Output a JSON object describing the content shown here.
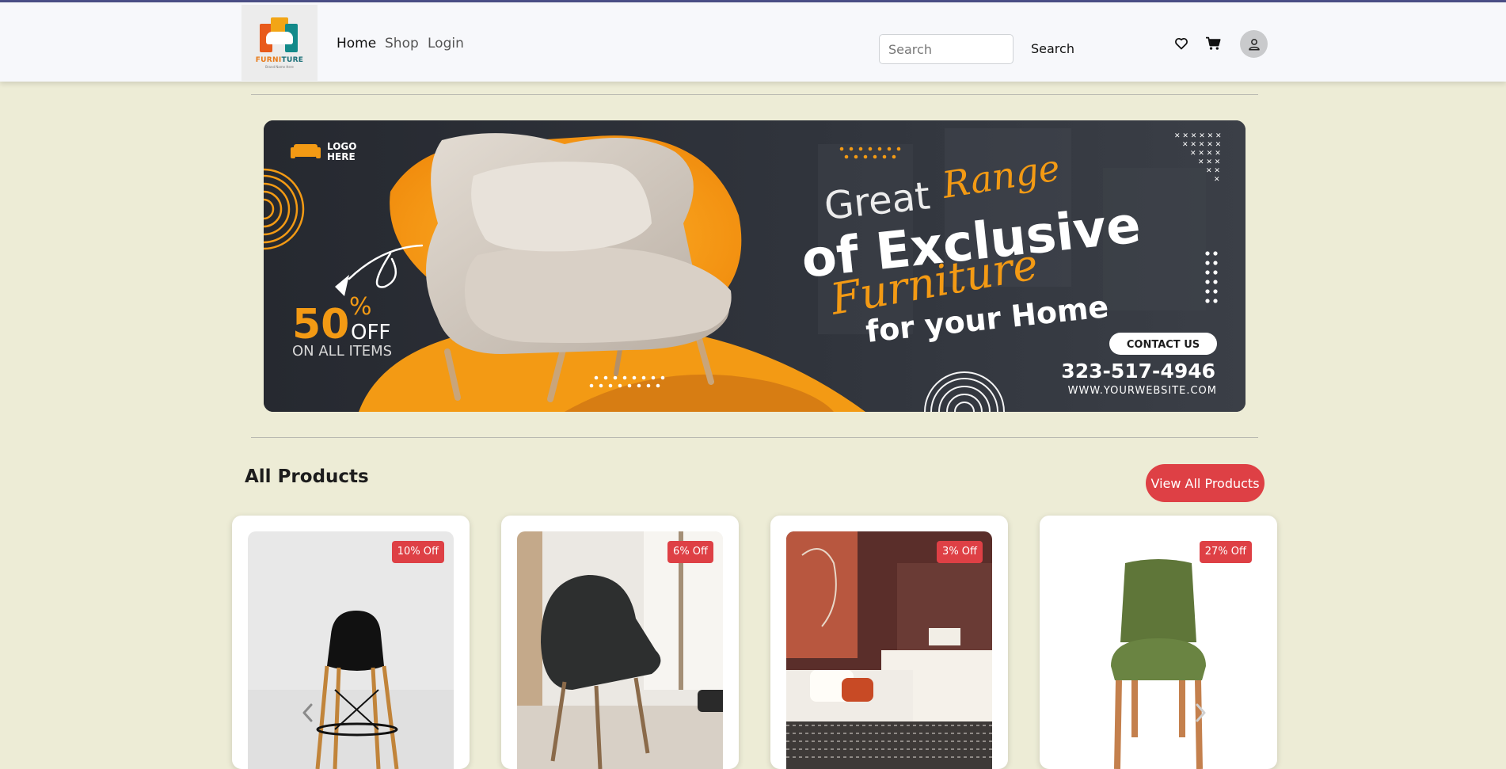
{
  "nav": {
    "logo_word_1": "FURNI",
    "logo_word_2": "TURE",
    "logo_tagline": "Brand Name Here",
    "links": [
      "Home",
      "Shop",
      "Login"
    ],
    "search_placeholder": "Search",
    "search_button": "Search",
    "icons": [
      "heart-icon",
      "cart-icon",
      "user-icon"
    ]
  },
  "banner": {
    "logo_line1": "LOGO",
    "logo_line2": "HERE",
    "discount_number": "50",
    "discount_pct": "%",
    "discount_off": "OFF",
    "discount_sub": "ON ALL ITEMS",
    "headline_great": "Great",
    "headline_range": "Range",
    "headline_exclusive": "of Exclusive",
    "headline_furniture": "Furniture",
    "headline_home": "for your Home",
    "contact_button": "CONTACT US",
    "phone": "323-517-4946",
    "website": "WWW.YOURWEBSITE.COM",
    "accent_color": "#f39a14"
  },
  "products_section": {
    "title": "All Products",
    "view_all": "View All Products",
    "cards": [
      {
        "discount": "10% Off",
        "image": "black bar stool"
      },
      {
        "discount": "6% Off",
        "image": "black lounge armchair"
      },
      {
        "discount": "3% Off",
        "image": "hotel bed"
      },
      {
        "discount": "27% Off",
        "image": "green dining chair"
      }
    ]
  },
  "colors": {
    "page_bg": "#edecd6",
    "nav_bg": "#f7f8fb",
    "accent_red": "#de4045"
  }
}
